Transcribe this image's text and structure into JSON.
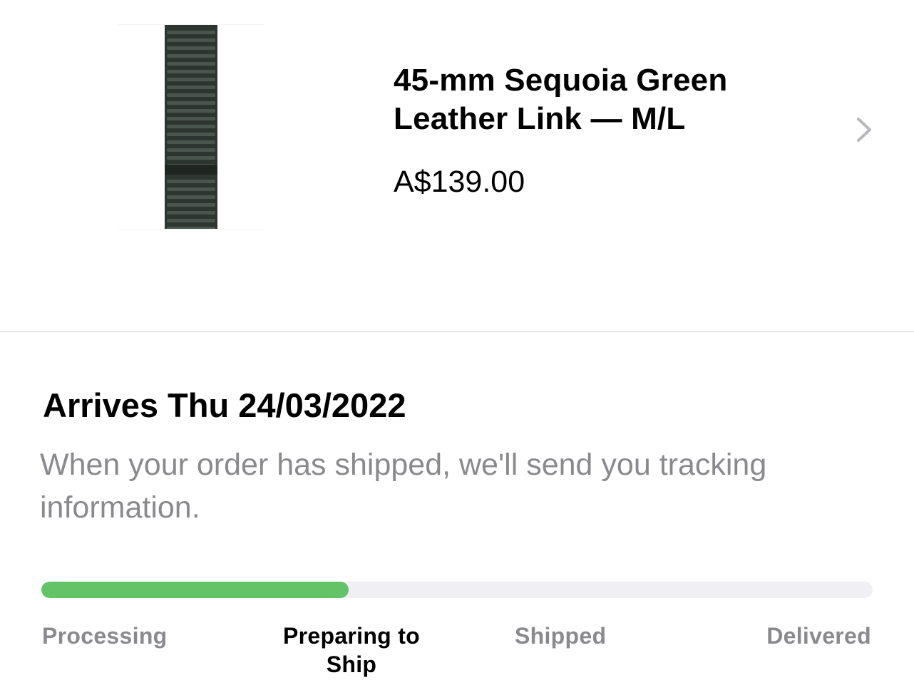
{
  "product": {
    "image_icon": "sequoia-green-leather-link-band",
    "title": "45-mm Sequoia Green Leather Link — M/L",
    "price": "A$139.00",
    "band_color": "#2f3a33"
  },
  "delivery": {
    "arrival": "Arrives Thu 24/03/2022",
    "note": "When your order has shipped, we'll send you tracking information.",
    "progress_fraction": 0.37,
    "progress_color": "#62c466",
    "track_color": "#efeff4",
    "steps": [
      {
        "label": "Processing",
        "active": false
      },
      {
        "label": "Preparing to Ship",
        "active": true
      },
      {
        "label": "Shipped",
        "active": false
      },
      {
        "label": "Delivered",
        "active": false
      }
    ]
  }
}
